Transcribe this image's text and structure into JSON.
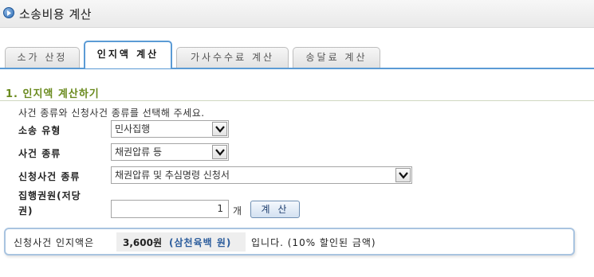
{
  "header": {
    "title": "소송비용 계산"
  },
  "tabs": [
    {
      "label": "소가 산정",
      "active": false
    },
    {
      "label": "인지액 계산",
      "active": true
    },
    {
      "label": "가사수수료 계산",
      "active": false
    },
    {
      "label": "송달료 계산",
      "active": false
    }
  ],
  "section": {
    "heading": "1. 인지액 계산하기",
    "instruction": "사건 종류와 신청사건 종류를 선택해 주세요."
  },
  "form": {
    "lawsuit_type": {
      "label": "소송 유형",
      "value": "민사집행"
    },
    "case_type": {
      "label": "사건 종류",
      "value": "채권압류 등"
    },
    "application_type": {
      "label": "신청사건 종류",
      "value": "채권압류 및 추심명령 신청서"
    },
    "execution_title": {
      "label_line1": "집행권원(저당",
      "label_line2": "권)",
      "value": "1",
      "unit": "개"
    },
    "calculate_button": "계 산"
  },
  "result": {
    "prefix": "신청사건 인지액은",
    "amount": "3,600원",
    "amount_hangul": "(삼천육백 원)",
    "suffix": "입니다. (10% 할인된 금액)"
  },
  "colors": {
    "accent": "#5b9bd5",
    "heading": "#6a8a1e",
    "hangul_amount": "#2b5c9c"
  }
}
